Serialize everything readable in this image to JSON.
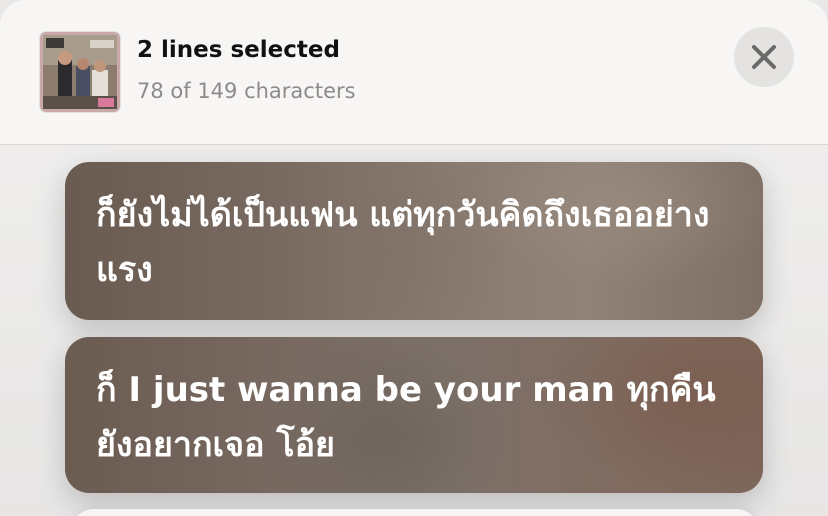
{
  "header": {
    "title": "2 lines selected",
    "subtitle": "78 of 149 characters"
  },
  "icons": {
    "close": "close-icon",
    "artwork": "album-artwork"
  },
  "colors": {
    "sheet_background": "#f3f2f1",
    "close_button_bg": "#e4e3e2",
    "card_base": "#7a6a60",
    "lyric_text": "#ffffff"
  },
  "lyrics": [
    {
      "text": "ก็ยังไม่ได้เป็นแฟน แต่ทุกวันคิดถึงเธออย่างแรง"
    },
    {
      "text": "ก็ I just wanna be your man ทุกคืนยังอยากเจอ โอ้ย"
    }
  ]
}
